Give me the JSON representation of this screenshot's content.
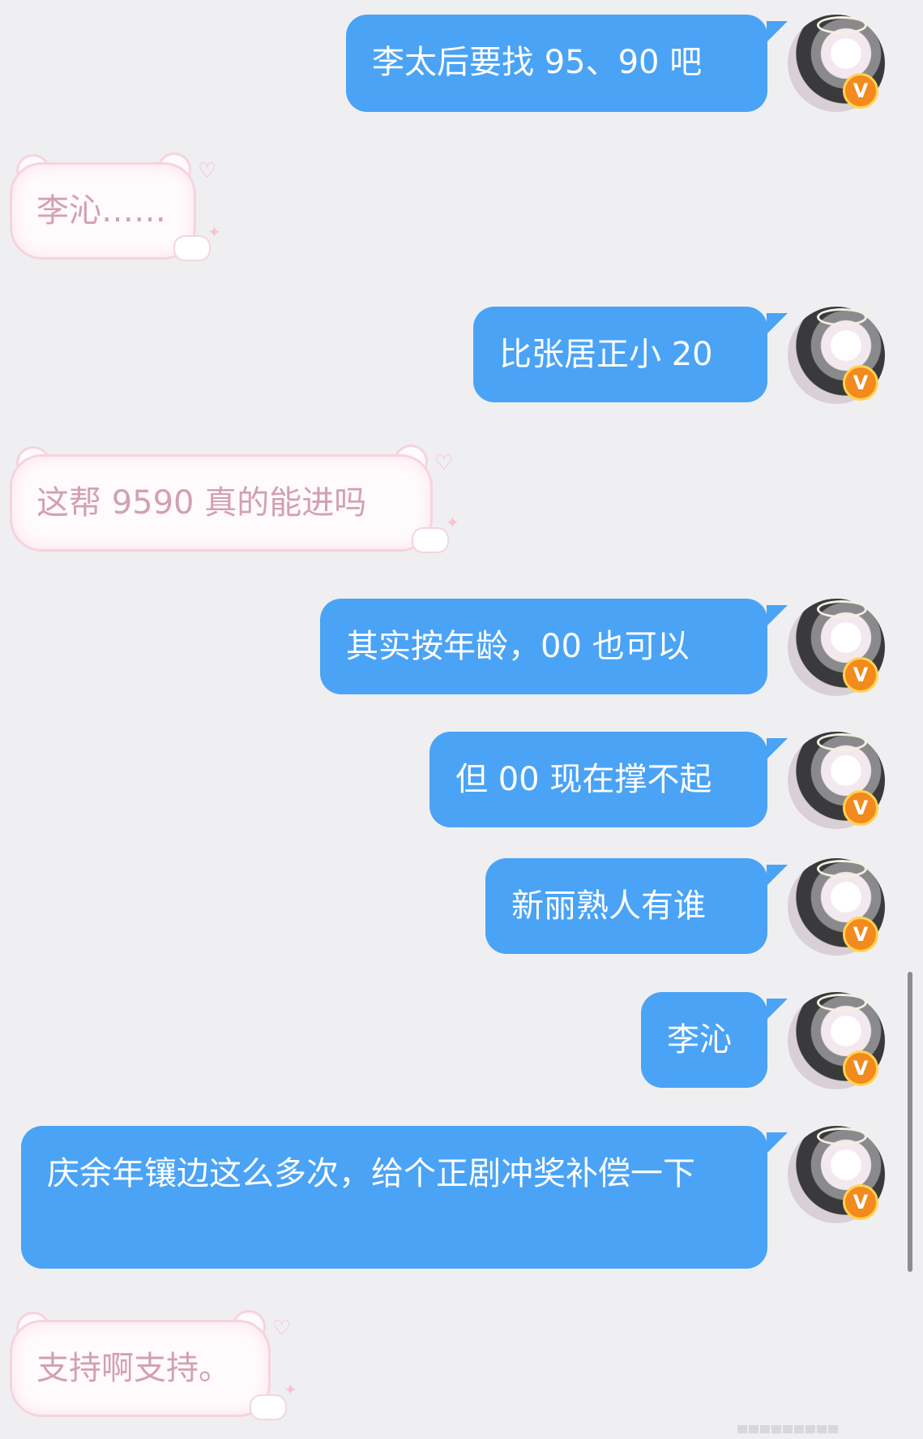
{
  "colors": {
    "background": "#efeff1",
    "sent_bubble": "#4aa3f5",
    "sent_text": "#ffffff",
    "received_text": "#d2a0b3",
    "received_border": "#f6d3df",
    "vip_badge": "#f28a1e"
  },
  "icons": {
    "avatar": "cat-angel-avatar",
    "verified_badge": "v-badge-icon"
  },
  "messages": [
    {
      "side": "right",
      "text": "李太后要找 95、90 吧",
      "badge": "V"
    },
    {
      "side": "left",
      "text": "李沁……"
    },
    {
      "side": "right",
      "text": "比张居正小 20",
      "badge": "V"
    },
    {
      "side": "left",
      "text": "这帮 9590 真的能进吗"
    },
    {
      "side": "right",
      "text": "其实按年龄，00 也可以",
      "badge": "V"
    },
    {
      "side": "right",
      "text": "但 00 现在撑不起",
      "badge": "V"
    },
    {
      "side": "right",
      "text": "新丽熟人有谁",
      "badge": "V"
    },
    {
      "side": "right",
      "text": "李沁",
      "badge": "V"
    },
    {
      "side": "right",
      "text": "庆余年镶边这么多次，给个正剧冲奖补偿一下",
      "badge": "V"
    },
    {
      "side": "left",
      "text": "支持啊支持。"
    }
  ]
}
